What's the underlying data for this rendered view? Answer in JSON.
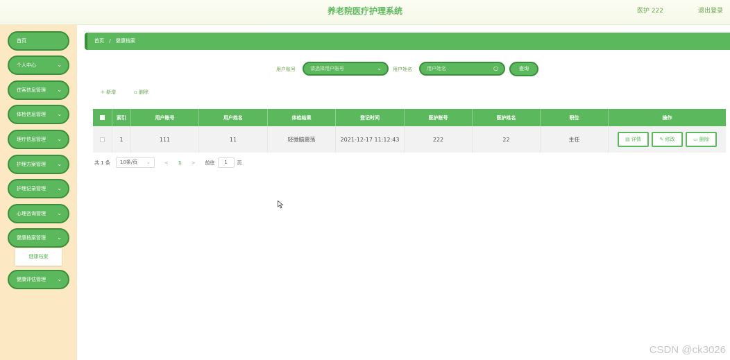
{
  "header": {
    "title": "养老院医疗护理系统",
    "user": "医护 222",
    "logout": "退出登录"
  },
  "sidebar": {
    "items": [
      {
        "label": "首页",
        "has_chevron": false
      },
      {
        "label": "个人中心",
        "has_chevron": true
      },
      {
        "label": "住客信息管理",
        "has_chevron": true
      },
      {
        "label": "体检信息管理",
        "has_chevron": true
      },
      {
        "label": "理疗信息管理",
        "has_chevron": true
      },
      {
        "label": "护理方案管理",
        "has_chevron": true
      },
      {
        "label": "护理记录管理",
        "has_chevron": true
      },
      {
        "label": "心理咨询管理",
        "has_chevron": true
      },
      {
        "label": "健康档案管理",
        "has_chevron": true
      },
      {
        "label": "健康评估管理",
        "has_chevron": true
      }
    ],
    "submenu_active": "健康档案",
    "chevron": "⌄"
  },
  "breadcrumb": {
    "home": "首页",
    "sep": "/",
    "current": "健康档案"
  },
  "search": {
    "account_label": "用户账号",
    "account_placeholder": "请选择用户账号",
    "name_label": "用户姓名",
    "name_placeholder": "用户姓名",
    "query_button": "查询"
  },
  "actions": {
    "add": "+ 新增",
    "delete": "删除"
  },
  "table": {
    "columns": [
      "索引",
      "用户账号",
      "用户姓名",
      "体检结果",
      "登记时间",
      "医护账号",
      "医护姓名",
      "职位",
      "操作"
    ],
    "rows": [
      [
        "1",
        "111",
        "11",
        "轻微脑震荡",
        "2021-12-17 11:12:43",
        "222",
        "22",
        "主任"
      ]
    ],
    "row_buttons": {
      "detail": "详情",
      "edit": "修改",
      "delete": "删除"
    }
  },
  "pagination": {
    "total": "共 1 条",
    "page_size": "10条/页",
    "prev": "<",
    "current_page": "1",
    "next": ">",
    "goto_label": "前往",
    "goto_value": "1",
    "page_unit": "页"
  },
  "watermark": "CSDN @ck3026",
  "colors": {
    "primary": "#5cb85c",
    "primary_dark": "#3a8f3a",
    "sidebar_bg": "#fde8c4"
  }
}
